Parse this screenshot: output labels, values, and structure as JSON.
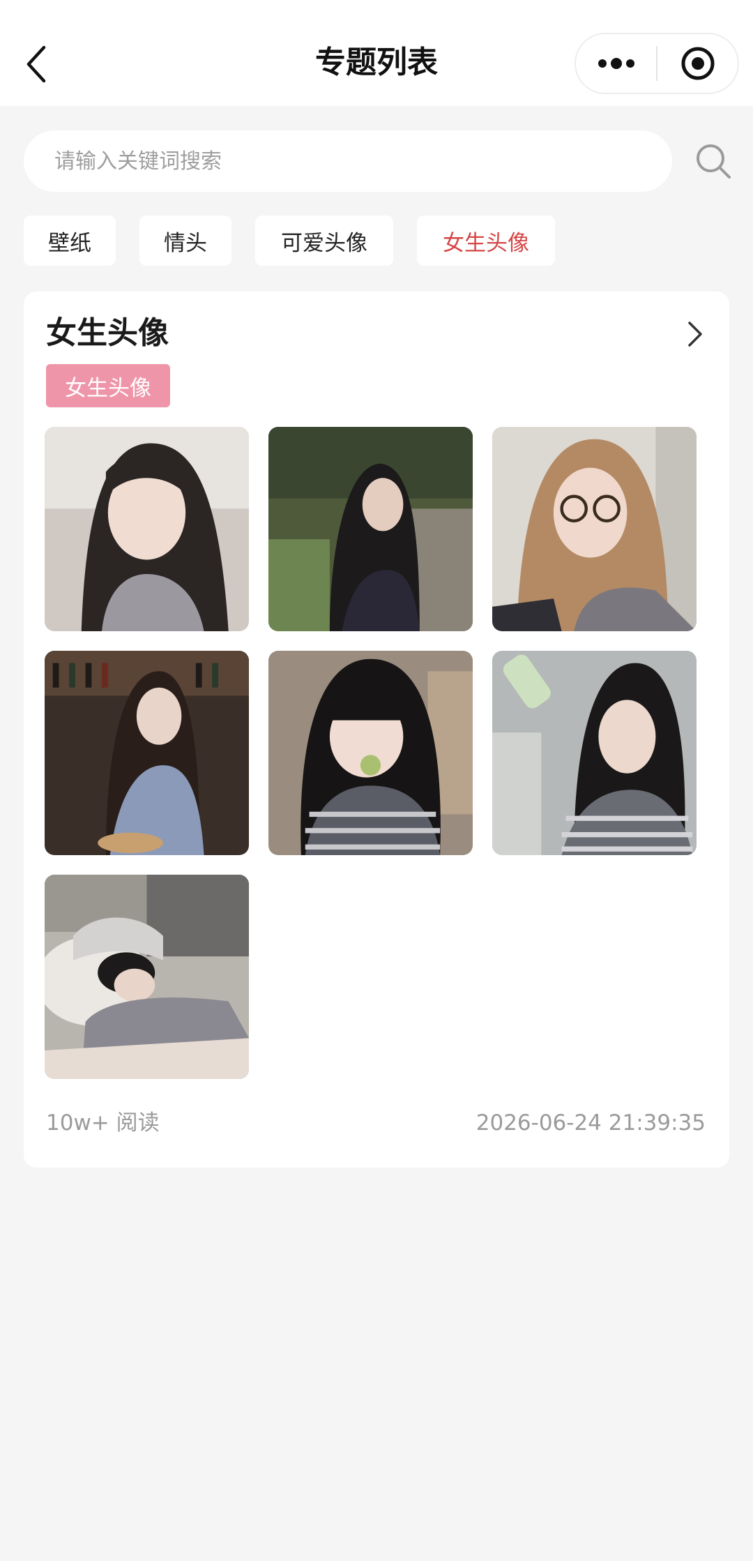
{
  "nav": {
    "title": "专题列表"
  },
  "search": {
    "placeholder": "请输入关键词搜索"
  },
  "tags": [
    {
      "label": "壁纸",
      "active": false
    },
    {
      "label": "情头",
      "active": false
    },
    {
      "label": "可爱头像",
      "active": false
    },
    {
      "label": "女生头像",
      "active": true
    }
  ],
  "topic": {
    "title": "女生头像",
    "badge": "女生头像",
    "reads": "10w+ 阅读",
    "timestamp": "2026-06-24 21:39:35",
    "images": [
      {
        "subject": "girl-portrait-long-dark-hair"
      },
      {
        "subject": "girl-in-garden-profile"
      },
      {
        "subject": "girl-with-glasses-selfie"
      },
      {
        "subject": "girl-in-bar-drinking"
      },
      {
        "subject": "girl-with-bangs-striped-top"
      },
      {
        "subject": "girl-holding-bottle"
      },
      {
        "subject": "girl-sleeping-on-bed"
      }
    ]
  },
  "colors": {
    "accent": "#d64545",
    "badge": "#ef95a9",
    "background": "#f5f5f5",
    "muted_text": "#9a9a9a"
  }
}
